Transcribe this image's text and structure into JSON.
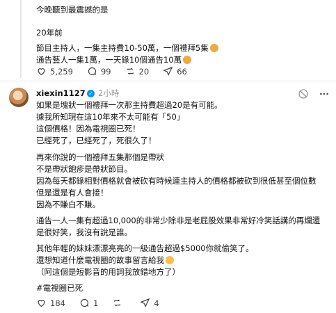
{
  "prev_post": {
    "lines": [
      "今晚聽到最震撼的是",
      "20年前",
      "節目主持人，一集主持費10-50萬，一個禮拜5集",
      "通告藝人一集1萬，一天錄10個通告10萬"
    ],
    "stats": {
      "likes": "5,259",
      "comments": "99",
      "reposts": "20",
      "shares": "66"
    }
  },
  "reply": {
    "username": "xiexin1127",
    "time": "2小時",
    "paragraphs": [
      [
        "如果是塊狀一個禮拜一次那主持費超過20是有可能。",
        "據我所知現在這10年來不太可能有「50」",
        "這個價格！因為電視圈已死！",
        "已經死了，已經死了，死很久了！"
      ],
      [
        "再來你說的一個禮拜五集那個是帶狀",
        "不是帶狀飽疹是帶狀節目。",
        "因為每天都錄相對價格就會被砍有時候連主持人的價格都被砍到很低甚至個位數",
        "但是還是有人會接！",
        "因為不賺白不賺。"
      ],
      [
        "通告一人一集有超過10,000的非常少除非是老屁股效果非常好冷笑話講的再爛還",
        "是很好笑，我沒有說是誰。"
      ],
      [
        "其他年輕的妹妹漂漂亮亮的一級通告超過$5000你就偷笑了。",
        "還想知道什麼電視圈的故事留言給我",
        "（阿這個是短影音的用詞我放錯地方了）"
      ],
      [
        "#電視圈已死"
      ]
    ],
    "stats": {
      "likes": "184",
      "comments": "1",
      "reposts": "",
      "shares": "4"
    }
  },
  "colors": {
    "text": "#101010",
    "muted": "#999999",
    "verified": "#0095f6",
    "emoji_red": "#f0a020"
  }
}
